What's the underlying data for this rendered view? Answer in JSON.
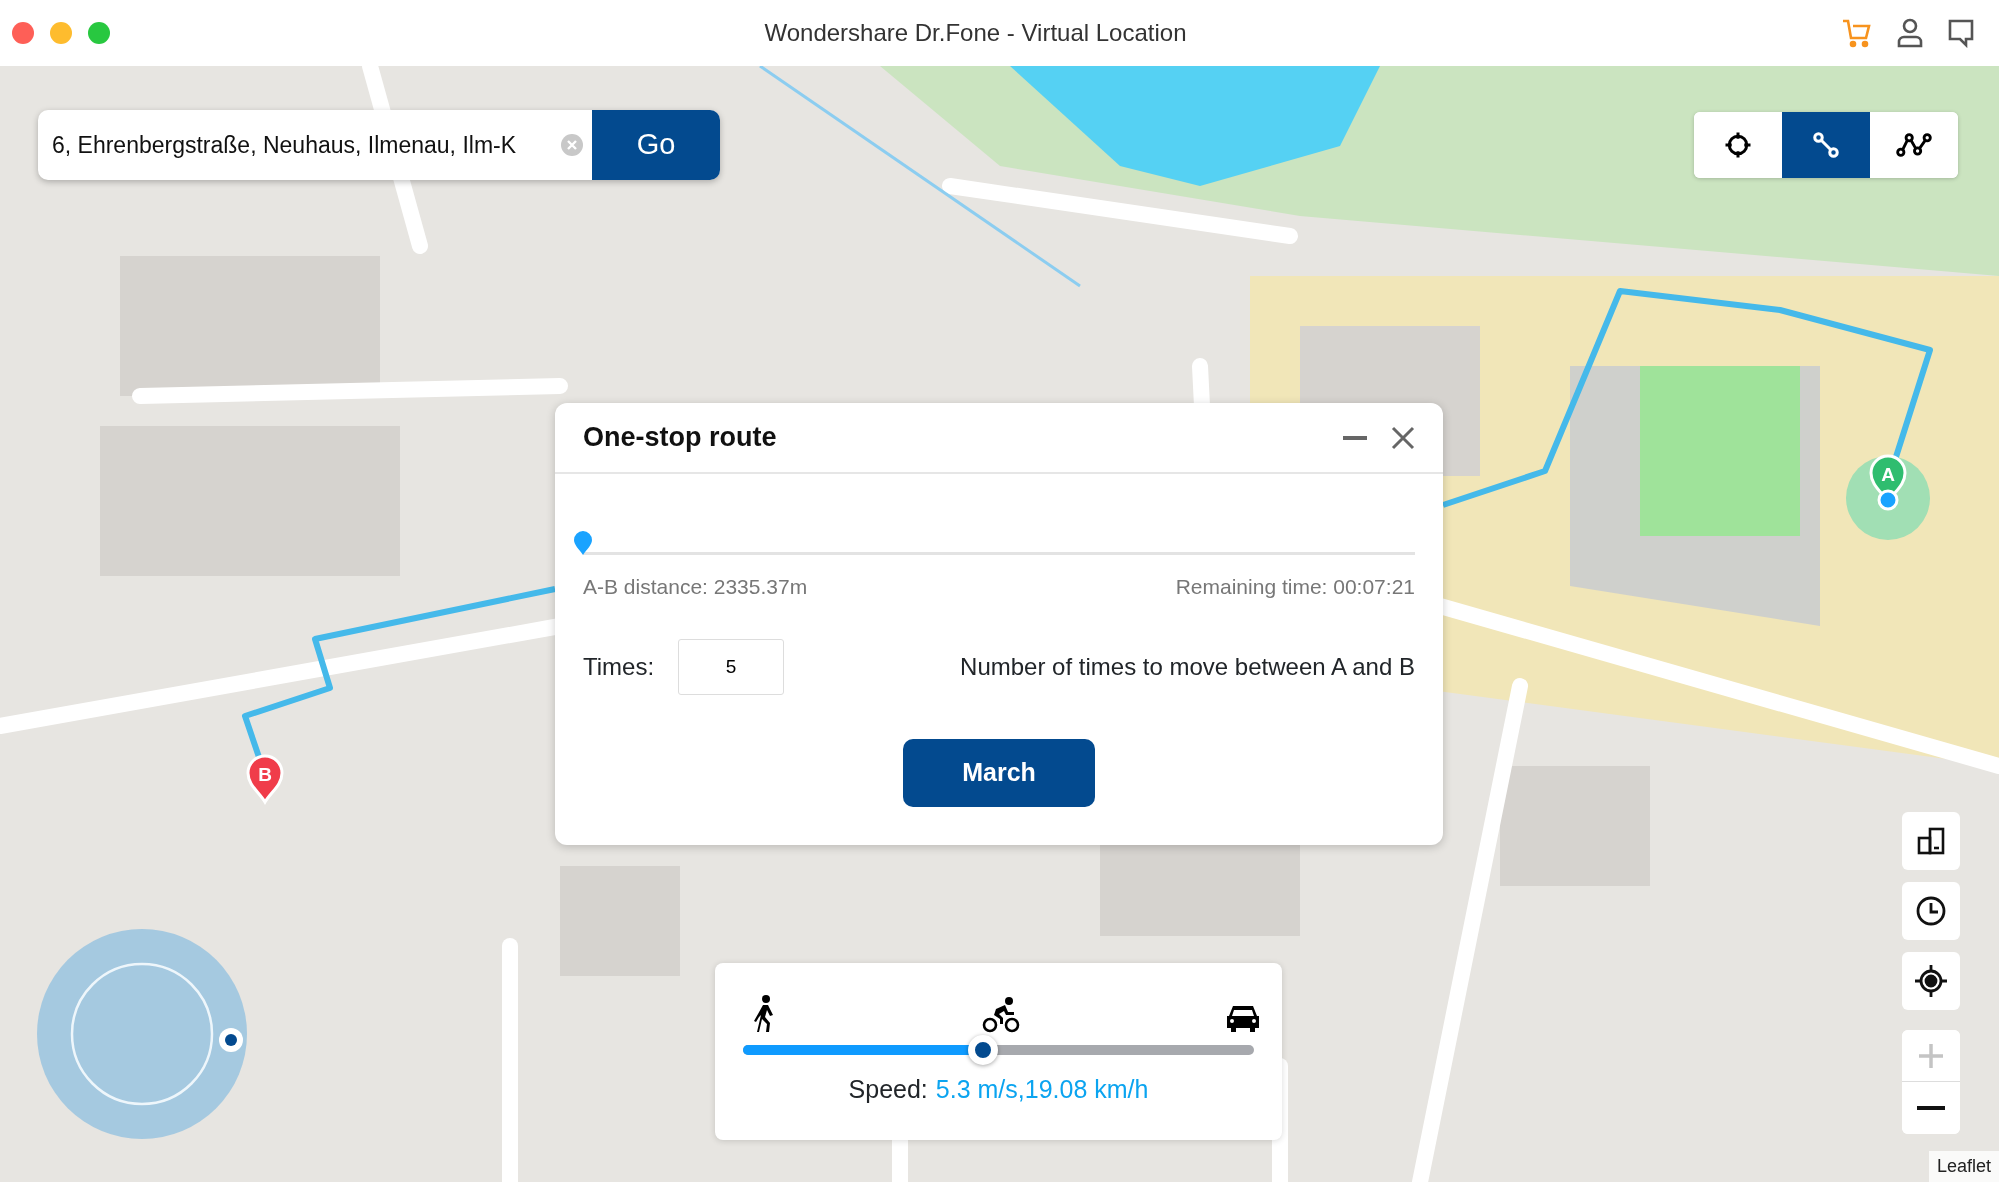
{
  "window": {
    "title": "Wondershare Dr.Fone - Virtual Location"
  },
  "search": {
    "value": "6, Ehrenbergstraße, Neuhaus, Ilmenau, Ilm-K",
    "button": "Go"
  },
  "modes": [
    {
      "kind": "teleport",
      "selected": false
    },
    {
      "kind": "one-stop",
      "selected": true
    },
    {
      "kind": "multi-stop",
      "selected": false
    }
  ],
  "dialog": {
    "title": "One-stop route",
    "progress": {
      "level": 0
    },
    "distance": "A-B distance: 2335.37m",
    "remaining": "Remaining time: 00:07:21",
    "times_label": "Times:",
    "times_value": "5",
    "times_hint": "Number of times to move between A and B",
    "button": "March"
  },
  "speed": {
    "level": 0.47,
    "label": "Speed:",
    "value": "5.3 m/s,19.08 km/h"
  },
  "map": {
    "markers": [
      {
        "label": "A"
      },
      {
        "label": "B"
      }
    ],
    "zoom_in": {
      "disabled": true
    },
    "attribution": "Leaflet"
  }
}
